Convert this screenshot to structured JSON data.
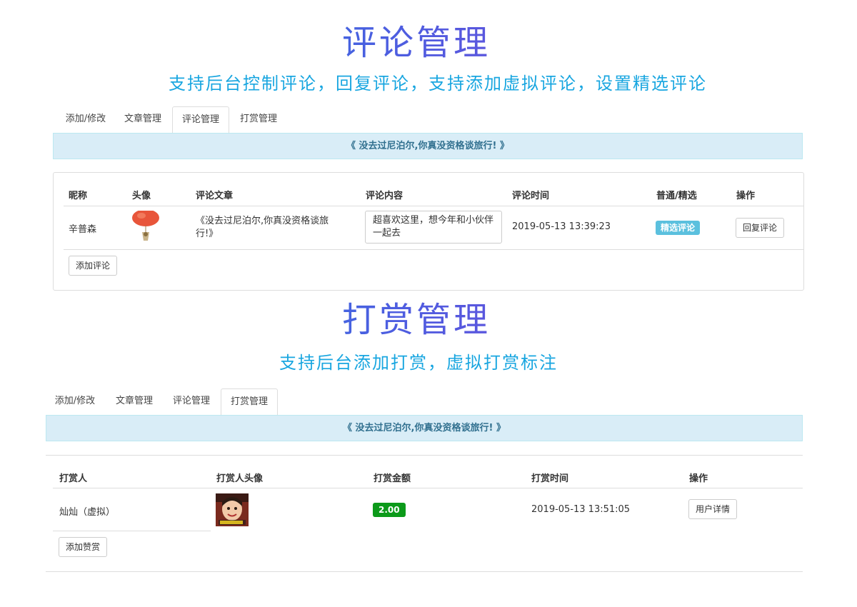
{
  "section1": {
    "title": "评论管理",
    "subtitle": "支持后台控制评论，回复评论，支持添加虚拟评论，设置精选评论",
    "tabs": [
      "添加/修改",
      "文章管理",
      "评论管理",
      "打赏管理"
    ],
    "active_tab": "评论管理",
    "banner": "《 没去过尼泊尔,你真没资格谈旅行! 》",
    "table": {
      "headers": [
        "昵称",
        "头像",
        "评论文章",
        "评论内容",
        "评论时间",
        "普通/精选",
        "操作"
      ],
      "rows": [
        {
          "nickname": "辛普森",
          "avatar_icon": "balloon-avatar-icon",
          "article": "《没去过尼泊尔,你真没资格谈旅行!》",
          "content": "超喜欢这里，想今年和小伙伴一起去",
          "time": "2019-05-13 13:39:23",
          "status": "精选评论",
          "action": "回复评论"
        }
      ]
    },
    "add_button": "添加评论"
  },
  "section2": {
    "title": "打赏管理",
    "subtitle": "支持后台添加打赏，虚拟打赏标注",
    "tabs": [
      "添加/修改",
      "文章管理",
      "评论管理",
      "打赏管理"
    ],
    "active_tab": "打赏管理",
    "banner": "《 没去过尼泊尔,你真没资格谈旅行! 》",
    "table": {
      "headers": [
        "打赏人",
        "打赏人头像",
        "打赏金额",
        "打赏时间",
        "操作"
      ],
      "rows": [
        {
          "tipper": "灿灿（虚拟）",
          "avatar_icon": "child-photo-avatar-icon",
          "amount": "2.00",
          "time": "2019-05-13 13:51:05",
          "action": "用户详情"
        }
      ]
    },
    "add_button": "添加赞赏"
  },
  "colors": {
    "title_gradient": [
      "#1a8fe0",
      "#8a3cd8"
    ],
    "subtitle": "#19a6e0",
    "banner_bg": "#d9edf7",
    "banner_text": "#31708f",
    "label_info": "#5bc0de",
    "label_success": "#0c9a1a"
  }
}
